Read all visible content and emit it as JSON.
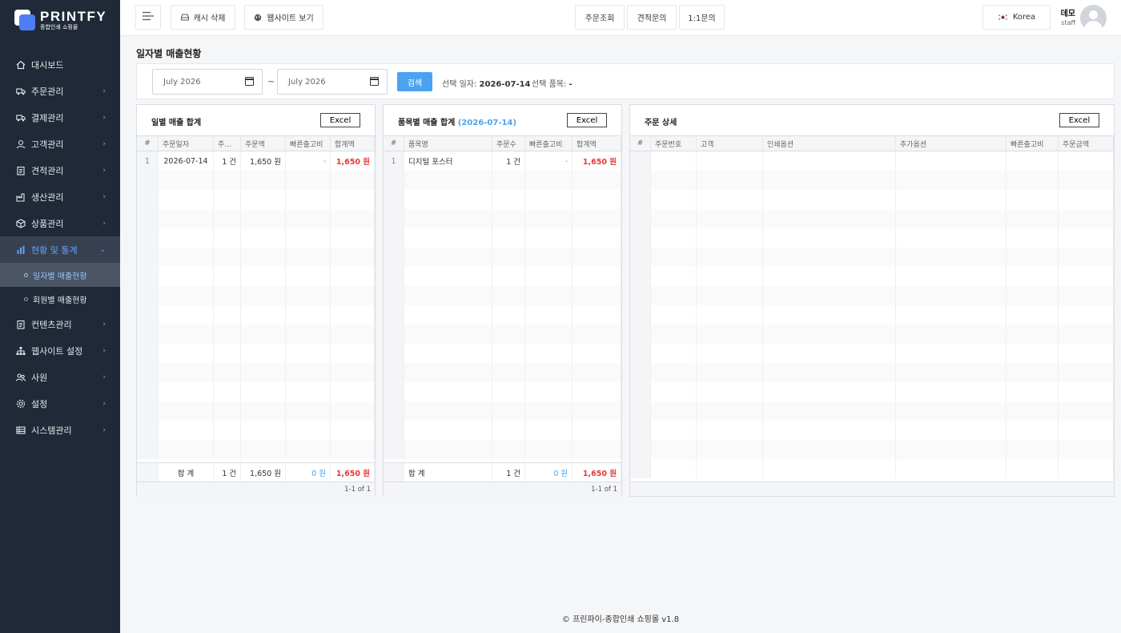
{
  "app": {
    "logo_name": "PRINTFY",
    "logo_sub": "종합인쇄 쇼핑몰"
  },
  "sidebar": {
    "items": [
      {
        "label": "대시보드",
        "icon": "home-icon"
      },
      {
        "label": "주문관리",
        "icon": "truck-icon"
      },
      {
        "label": "결제관리",
        "icon": "truck-icon"
      },
      {
        "label": "고객관리",
        "icon": "user-icon"
      },
      {
        "label": "견적관리",
        "icon": "clipboard-icon"
      },
      {
        "label": "생산관리",
        "icon": "factory-icon"
      },
      {
        "label": "상품관리",
        "icon": "box-icon"
      },
      {
        "label": "현황 및 통계",
        "icon": "bar-chart-icon"
      }
    ],
    "sub_items": [
      {
        "label": "일자별 매출현황"
      },
      {
        "label": "회원별 매출현황"
      }
    ],
    "items2": [
      {
        "label": "컨텐츠관리",
        "icon": "clipboard-icon"
      },
      {
        "label": "웹사이트 설정",
        "icon": "sitemap-icon"
      },
      {
        "label": "사원",
        "icon": "users-icon"
      },
      {
        "label": "설정",
        "icon": "gear-icon"
      },
      {
        "label": "시스템관리",
        "icon": "list-icon"
      }
    ]
  },
  "topbar": {
    "cache_clear": "캐시 삭제",
    "view_site": "웹사이트 보기",
    "order_lookup": "주문조회",
    "quote_inquiry": "견적문의",
    "one_to_one": "1:1문의",
    "language": "Korea",
    "user_name": "데모",
    "user_role": "staff"
  },
  "page": {
    "title": "일자별 매출현황"
  },
  "filter": {
    "date_from": "July 2026",
    "date_to": "July 2026",
    "tilde": "~",
    "search_label": "검색",
    "selected_date_label": "선택 일자:",
    "selected_date_value": "2026-07-14",
    "selected_item_label": "선택 품목:",
    "selected_item_value": "-"
  },
  "daily_panel": {
    "title": "일별 매출 합계",
    "excel": "Excel",
    "headers": [
      "#",
      "주문일자",
      "주...",
      "주문액",
      "빠른출고비",
      "합계액"
    ],
    "rows": [
      {
        "n": "1",
        "date": "2026-07-14",
        "count": "1 건",
        "amount": "1,650 원",
        "fast_fee": "-",
        "total": "1,650 원"
      }
    ],
    "footer": {
      "label": "합 계",
      "count": "1 건",
      "amount": "1,650 원",
      "fast_fee": "0 원",
      "total": "1,650 원"
    },
    "pager": "1-1 of 1"
  },
  "item_panel": {
    "title": "품목별 매출 합계",
    "title_date": "(2026-07-14)",
    "excel": "Excel",
    "headers": [
      "#",
      "품목명",
      "주문수",
      "빠른출고비",
      "합계액"
    ],
    "rows": [
      {
        "n": "1",
        "name": "디지털 포스터",
        "count": "1 건",
        "fast_fee": "-",
        "total": "1,650 원"
      }
    ],
    "footer": {
      "label": "합 계",
      "count": "1 건",
      "fast_fee": "0 원",
      "total": "1,650 원"
    },
    "pager": "1-1 of 1"
  },
  "detail_panel": {
    "title": "주문 상세",
    "excel": "Excel",
    "headers": [
      "#",
      "주문번호",
      "고객",
      "인쇄옵션",
      "추가옵션",
      "빠른출고비",
      "주문금액"
    ]
  },
  "footer": {
    "text": "© 프린파이-종합인쇄 쇼핑몰 v1.8"
  },
  "colors": {
    "sidebar_bg": "#1f2937",
    "accent": "#4ba3f0",
    "total_red": "#e53935"
  }
}
